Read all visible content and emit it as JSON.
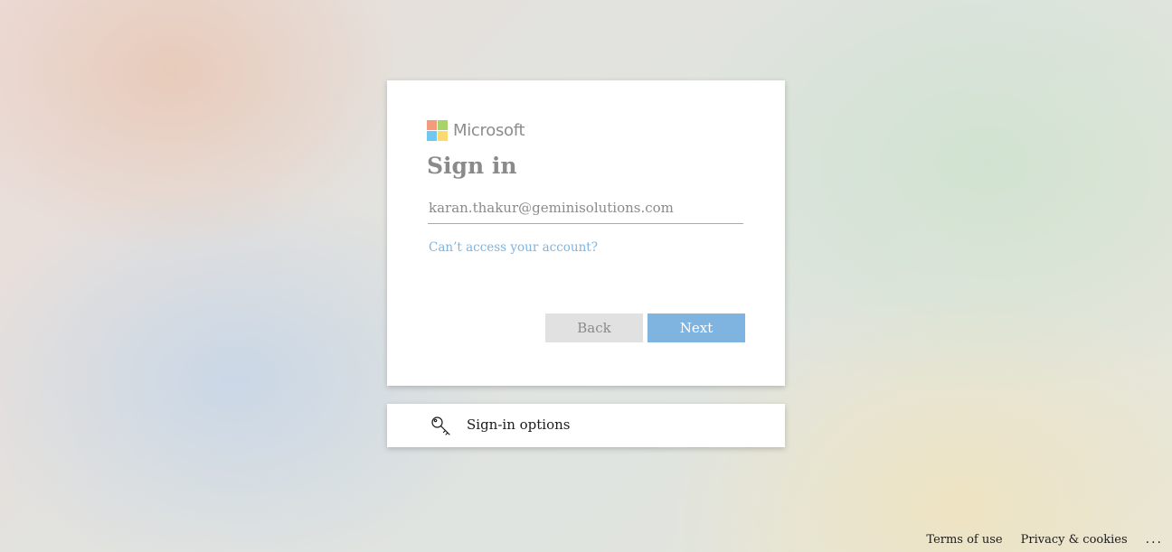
{
  "brand": {
    "name": "Microsoft",
    "logo_colors": [
      "#f25022",
      "#7fba00",
      "#00a4ef",
      "#ffb900"
    ]
  },
  "signin": {
    "title": "Sign in",
    "email_value": "karan.thakur@geminisolutions.com",
    "help_link": "Can’t access your account?",
    "back_label": "Back",
    "next_label": "Next"
  },
  "options": {
    "icon": "key-icon",
    "label": "Sign-in options"
  },
  "footer": {
    "terms": "Terms of use",
    "privacy": "Privacy & cookies",
    "more": "..."
  },
  "colors": {
    "accent": "#80b4e0",
    "link": "#7fb3e0",
    "title_text": "#8a8a8a"
  }
}
